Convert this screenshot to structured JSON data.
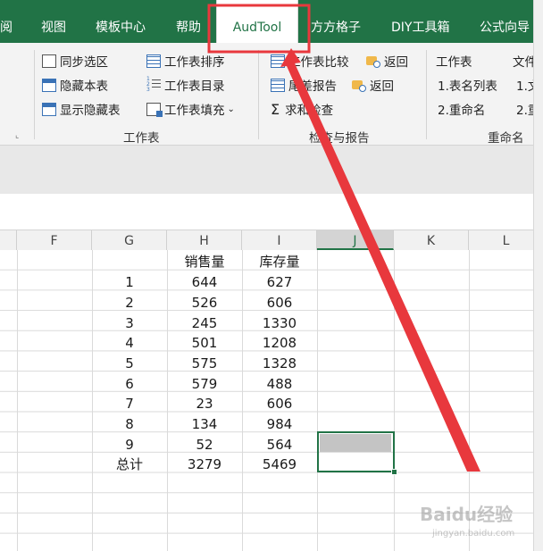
{
  "tabs": [
    {
      "label": "阅"
    },
    {
      "label": "视图"
    },
    {
      "label": "模板中心"
    },
    {
      "label": "帮助"
    },
    {
      "label": "AudTool"
    },
    {
      "label": "方方格子"
    },
    {
      "label": "DIY工具箱"
    },
    {
      "label": "公式向导"
    }
  ],
  "ribbon": {
    "left_partial": [
      "",
      "",
      ""
    ],
    "worksheet_group": {
      "sync_selection": "同步选区",
      "hide_sheet": "隐藏本表",
      "show_hidden": "显示隐藏表",
      "sort_sheets": "工作表排序",
      "sheet_index": "工作表目录",
      "fill_sheets": "工作表填充",
      "label": "工作表"
    },
    "check_group": {
      "compare": "工作表比较",
      "return1": "返回",
      "tail_report": "尾差报告",
      "return2": "返回",
      "sum_check": "求和检查",
      "label": "检查与报告"
    },
    "rename_group": {
      "worksheet": "工作表",
      "list_names": "1.表名列表",
      "rename": "2.重命名",
      "file": "文件",
      "file1": "1.文件",
      "file2": "2.重命",
      "label": "重命名"
    }
  },
  "columns": [
    "F",
    "G",
    "H",
    "I",
    "J",
    "K",
    "L"
  ],
  "selected_column": "J",
  "table": {
    "headers": {
      "sales": "销售量",
      "stock": "库存量"
    },
    "rows": [
      {
        "g": "1",
        "h": "644",
        "i": "627"
      },
      {
        "g": "2",
        "h": "526",
        "i": "606"
      },
      {
        "g": "3",
        "h": "245",
        "i": "1330"
      },
      {
        "g": "4",
        "h": "501",
        "i": "1208"
      },
      {
        "g": "5",
        "h": "575",
        "i": "1328"
      },
      {
        "g": "6",
        "h": "579",
        "i": "488"
      },
      {
        "g": "7",
        "h": "23",
        "i": "606"
      },
      {
        "g": "8",
        "h": "134",
        "i": "984"
      },
      {
        "g": "9",
        "h": "52",
        "i": "564"
      }
    ],
    "total": {
      "g": "总计",
      "h": "3279",
      "i": "5469"
    }
  },
  "annotation_color": "#e8383d",
  "accent_color": "#217346",
  "watermark": {
    "brand": "Baidu经验",
    "url": "jingyan.baidu.com"
  }
}
